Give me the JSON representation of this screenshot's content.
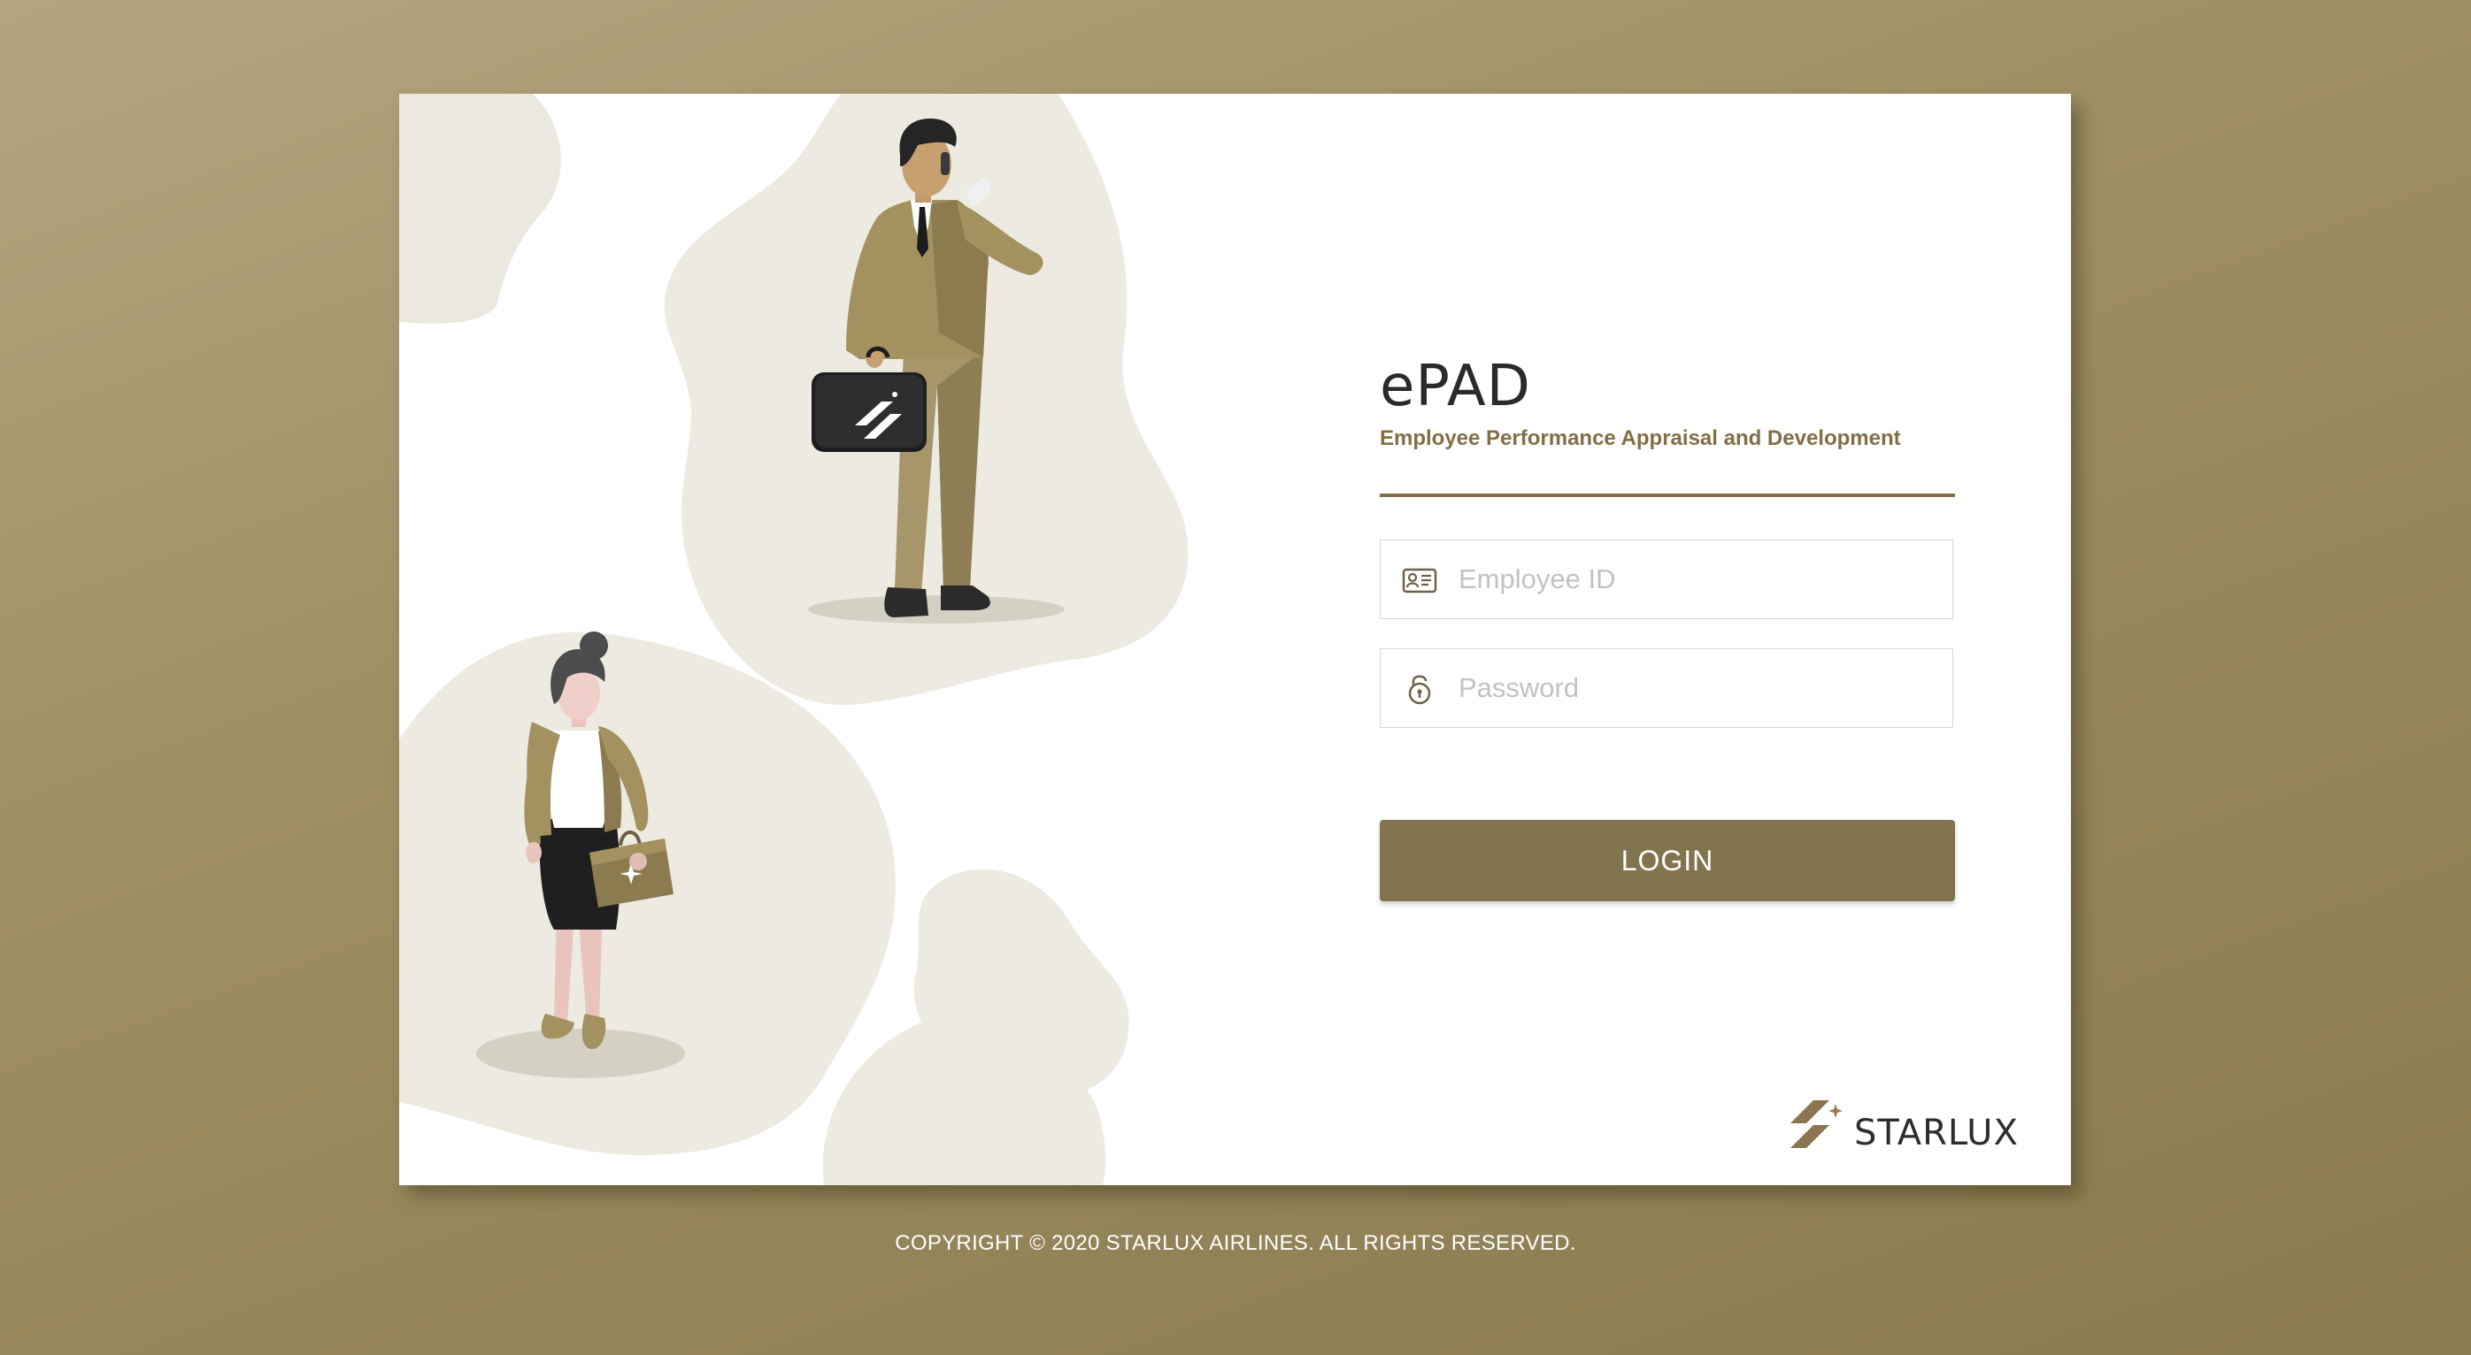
{
  "app": {
    "logo_title": "ePAD",
    "subtitle": "Employee Performance Appraisal and Development"
  },
  "form": {
    "employee_id": {
      "placeholder": "Employee ID",
      "value": "",
      "icon": "id-card-icon"
    },
    "password": {
      "placeholder": "Password",
      "value": "",
      "icon": "padlock-icon"
    },
    "login_label": "LOGIN"
  },
  "brand": {
    "name": "STARLUX",
    "icon": "starlux-logo-mark"
  },
  "footer": {
    "copyright": "COPYRIGHT © 2020 STARLUX AIRLINES. ALL RIGHTS RESERVED."
  },
  "colors": {
    "background": "#9e8e63",
    "accent": "#836f45",
    "button": "#837450",
    "blob": "#ebe8df"
  }
}
